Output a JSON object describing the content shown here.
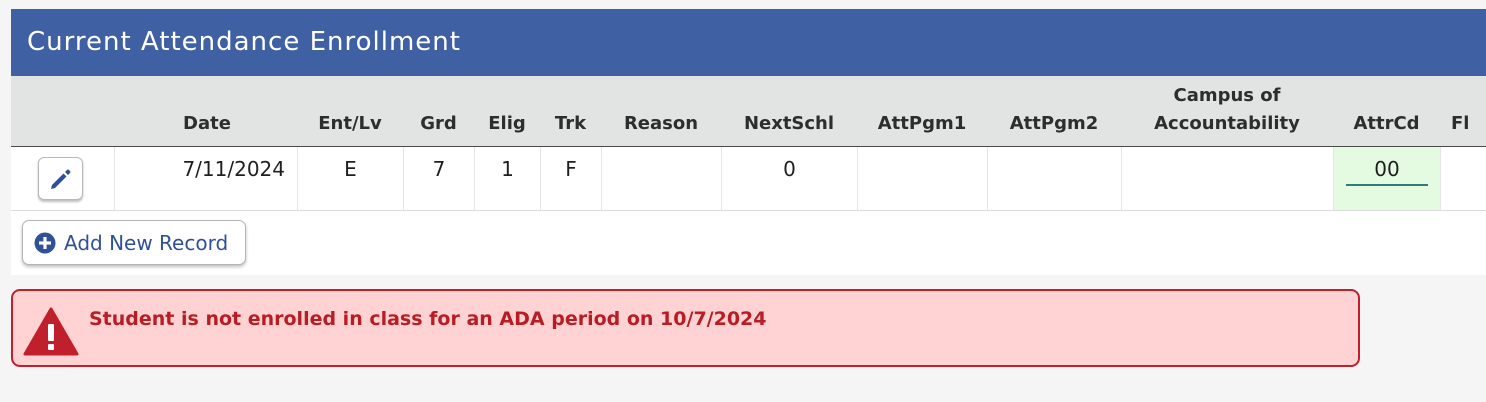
{
  "panel": {
    "title": "Current Attendance Enrollment"
  },
  "table": {
    "columns": [
      {
        "label": ""
      },
      {
        "label": "Date"
      },
      {
        "label": "Ent/Lv"
      },
      {
        "label": "Grd"
      },
      {
        "label": "Elig"
      },
      {
        "label": "Trk"
      },
      {
        "label": "Reason"
      },
      {
        "label": "NextSchl"
      },
      {
        "label": "AttPgm1"
      },
      {
        "label": "AttPgm2"
      },
      {
        "label": "Campus of",
        "label2": "Accountability"
      },
      {
        "label": "AttrCd"
      },
      {
        "label": "Fl"
      }
    ],
    "row": {
      "date": "7/11/2024",
      "ent_lv": "E",
      "grd": "7",
      "elig": "1",
      "trk": "F",
      "reason": "",
      "next_schl": "0",
      "att_pgm1": "",
      "att_pgm2": "",
      "campus_of_accountability": "",
      "attr_cd": "00",
      "fl": ""
    },
    "edit_icon": "pencil-icon"
  },
  "actions": {
    "add_record_label": "Add New Record",
    "add_icon": "plus-circle-icon"
  },
  "alert": {
    "icon": "warning-icon",
    "message": "Student is not enrolled in class for an ADA period on 10/7/2024",
    "color": "#b81d24",
    "background": "#ffd3d4"
  },
  "colors": {
    "header_bg": "#4060a4",
    "accent": "#30509a",
    "attr_cell_bg": "#e4fbe2"
  }
}
